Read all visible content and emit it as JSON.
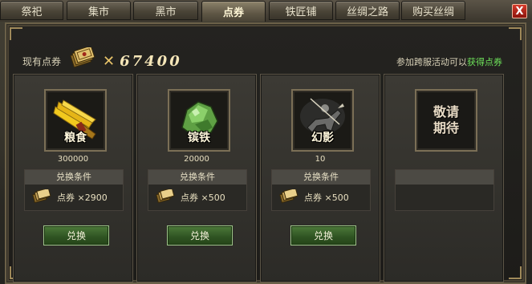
{
  "tabs": [
    {
      "label": "祭祀",
      "active": false
    },
    {
      "label": "集市",
      "active": false
    },
    {
      "label": "黑市",
      "active": false
    },
    {
      "label": "点券",
      "active": true
    },
    {
      "label": "铁匠铺",
      "active": false
    },
    {
      "label": "丝绸之路",
      "active": false
    },
    {
      "label": "购买丝绸",
      "active": false
    }
  ],
  "close_label": "X",
  "coupon": {
    "label": "现有点券",
    "times": "✕",
    "amount": "67400"
  },
  "promo": {
    "prefix": "参加跨服活动可以",
    "link": "获得点券"
  },
  "cards": [
    {
      "name": "粮食",
      "quantity": "300000",
      "cond_title": "兑换条件",
      "cost": "点券 ×2900",
      "button": "兑换"
    },
    {
      "name": "镔铁",
      "quantity": "20000",
      "cond_title": "兑换条件",
      "cost": "点券 ×500",
      "button": "兑换"
    },
    {
      "name": "幻影",
      "quantity": "10",
      "cond_title": "兑换条件",
      "cost": "点券 ×500",
      "button": "兑换"
    }
  ],
  "coming_soon": {
    "line1": "敬请",
    "line2": "期待"
  },
  "colors": {
    "accent_gold": "#e9c46a",
    "link_green": "#6ee35a",
    "close_red": "#d63a2a",
    "button_green": "#2e5222"
  },
  "icons": {
    "coupon": "coupon-stack-icon",
    "grain": "grain-bundle-icon",
    "iron": "iron-ore-icon",
    "phantom": "horse-rider-icon",
    "close": "close-icon"
  }
}
